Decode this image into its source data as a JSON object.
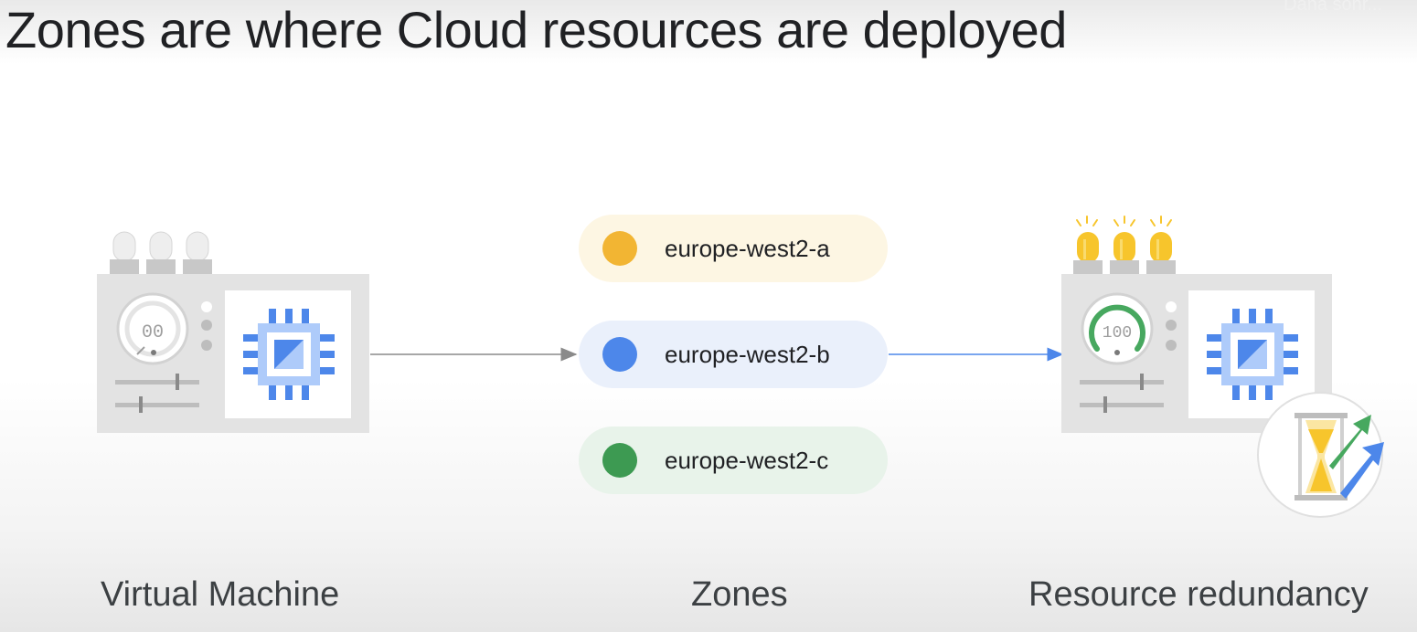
{
  "slide": {
    "title": "Zones are where Cloud resources are deployed",
    "corner_text": "Dana sonr..."
  },
  "vm": {
    "dial_text": "00",
    "caption": "Virtual Machine"
  },
  "zones": {
    "caption": "Zones",
    "items": [
      {
        "label": "europe-west2-a",
        "dot_color": "#f2b533",
        "bg_color": "#fdf6e3"
      },
      {
        "label": "europe-west2-b",
        "dot_color": "#4d87ea",
        "bg_color": "#eaf0fb"
      },
      {
        "label": "europe-west2-c",
        "dot_color": "#3d9a52",
        "bg_color": "#e8f3ea"
      }
    ]
  },
  "redundancy": {
    "dial_text": "100",
    "caption": "Resource redundancy"
  },
  "colors": {
    "machine_body": "#e3e3e3",
    "chip_blue": "#4d87ea",
    "light_blue": "#aecbfa",
    "bulb_on": "#f7c52c",
    "arrow_green": "#47a85f",
    "arrow_blue": "#4d87ea"
  },
  "icons": [
    "server-icon",
    "chip-icon",
    "hourglass-icon",
    "trend-up-arrow-icon"
  ]
}
